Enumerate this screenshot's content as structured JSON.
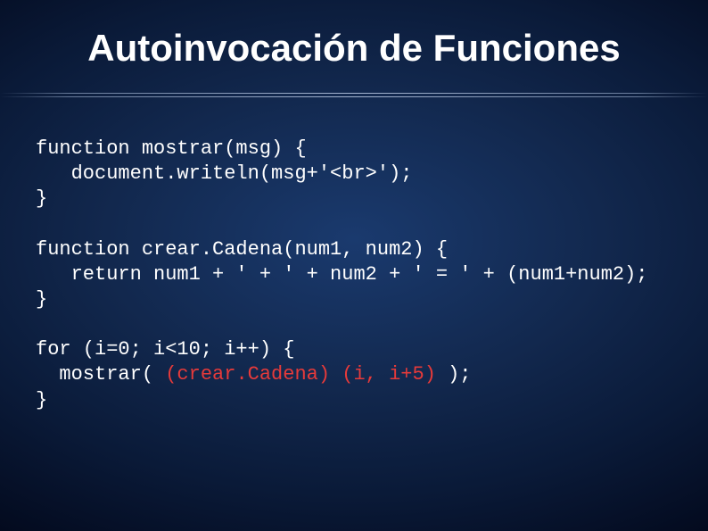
{
  "title": "Autoinvocación de Funciones",
  "code": {
    "l1": "function mostrar(msg) {",
    "l2": "   document.writeln(msg+'<br>');",
    "l3": "}",
    "l4": "",
    "l5": "function crear.Cadena(num1, num2) {",
    "l6": "   return num1 + ' + ' + num2 + ' = ' + (num1+num2);",
    "l7": "}",
    "l8": "",
    "l9": "for (i=0; i<10; i++) {",
    "l10a": "  mostrar( ",
    "l10b": "(crear.Cadena)",
    "l10c": " ",
    "l10d": "(i, i+5)",
    "l10e": " );",
    "l11": "}"
  }
}
